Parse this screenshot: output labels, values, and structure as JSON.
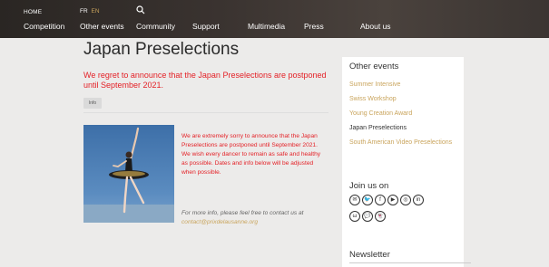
{
  "header": {
    "home": "HOME",
    "lang_fr": "FR",
    "lang_en": "EN",
    "nav": [
      "Competition",
      "Other events",
      "Community",
      "Support",
      "Multimedia",
      "Press",
      "About us"
    ]
  },
  "main": {
    "title": "Japan Preselections",
    "announcement": "We regret to announce that the Japan Preselections are postponed until September 2021.",
    "tag": "Info",
    "body": "We are extremely sorry to announce that the Japan Preselections are postponed until September 2021. We wish every dancer to remain as safe and healthy as possible. Dates and info below will be adjusted when possible.",
    "info_prefix": "For more info, please feel free to contact us at",
    "info_email": "contact@prixdelausanne.org"
  },
  "sidebar": {
    "title": "Other events",
    "links": [
      "Summer Intensive",
      "Swiss Workshop",
      "Young Creation Award",
      "Japan Preselections",
      "South American Video Preselections"
    ],
    "current_index": 3,
    "join_title": "Join us on",
    "newsletter_title": "Newsletter"
  },
  "colors": {
    "accent": "#c9a45c",
    "alert": "#e42127"
  }
}
